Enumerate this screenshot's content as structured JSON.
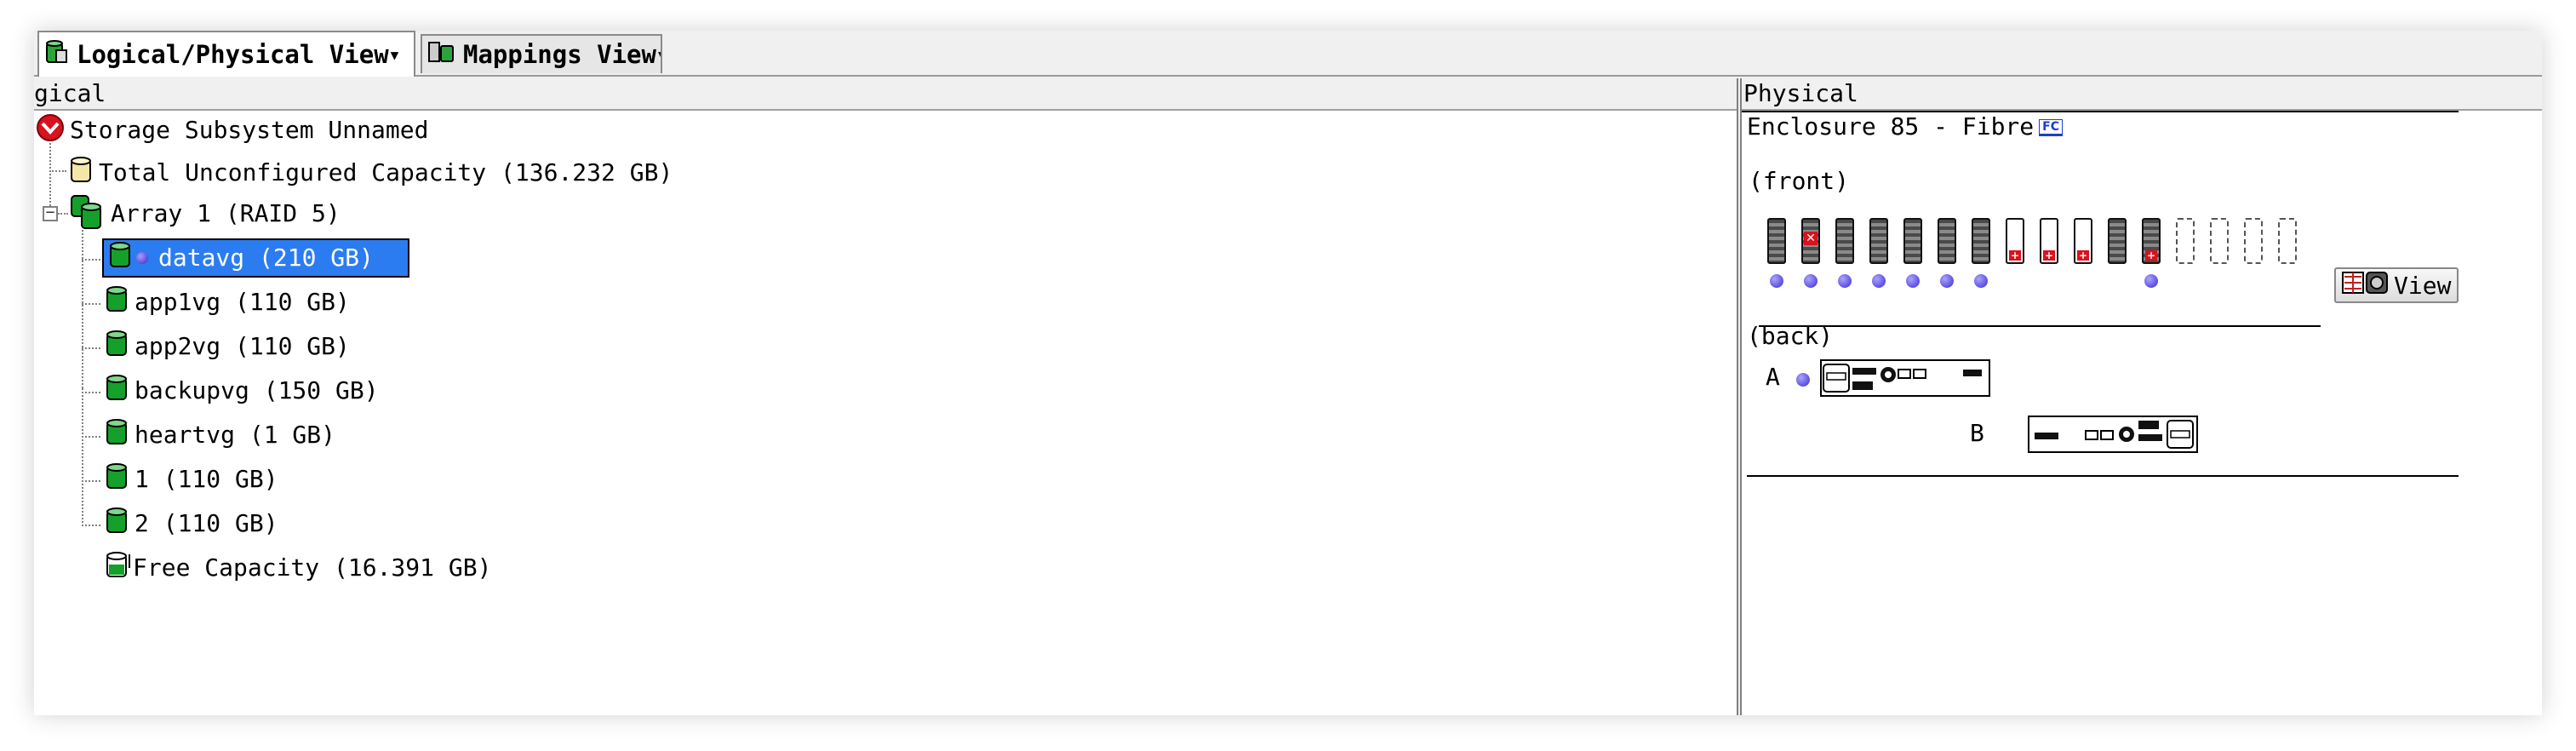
{
  "tabs": [
    {
      "label": "Logical/Physical View",
      "active": true
    },
    {
      "label": "Mappings View",
      "active": false
    }
  ],
  "logical": {
    "header": "gical",
    "tree": {
      "root": "Storage Subsystem Unnamed",
      "unconfigured": "Total Unconfigured Capacity (136.232 GB)",
      "array": "Array 1 (RAID 5)",
      "volumes": [
        {
          "label": "datavg (210 GB)",
          "selected": true
        },
        {
          "label": "app1vg (110 GB)"
        },
        {
          "label": "app2vg (110 GB)"
        },
        {
          "label": "backupvg (150 GB)"
        },
        {
          "label": "heartvg (1 GB)"
        },
        {
          "label": "1 (110 GB)"
        },
        {
          "label": "2 (110 GB)"
        }
      ],
      "free": "Free Capacity (16.391 GB)"
    }
  },
  "physical": {
    "header": "Physical",
    "enclosure": "Enclosure 85 - Fibre",
    "fc_badge": "FC",
    "front_label": "(front)",
    "back_label": "(back)",
    "controller_a": "A",
    "controller_b": "B",
    "view_button": "View",
    "drives": [
      "filled",
      "failed",
      "filled",
      "filled",
      "filled",
      "filled",
      "filled",
      "hotspare",
      "hotspare",
      "hotspare",
      "filled",
      "filled",
      "empty",
      "empty",
      "empty",
      "empty"
    ]
  },
  "colors": {
    "selection": "#2b7cf0",
    "volume_green": "#14a02a",
    "status_red": "#d8121e",
    "dot_purple": "#3a2bd0"
  }
}
